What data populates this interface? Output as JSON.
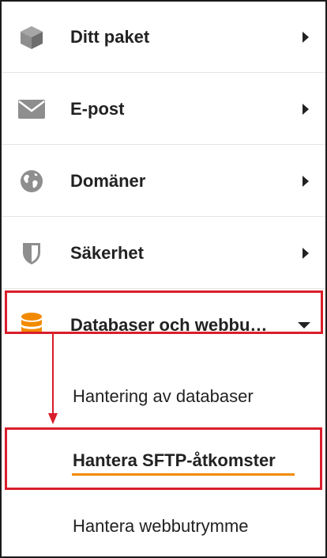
{
  "menu": {
    "items": [
      {
        "label": "Ditt paket",
        "icon": "package-icon",
        "chevron": "chevron-right-icon"
      },
      {
        "label": "E-post",
        "icon": "envelope-icon",
        "chevron": "chevron-right-icon"
      },
      {
        "label": "Domäner",
        "icon": "globe-icon",
        "chevron": "chevron-right-icon"
      },
      {
        "label": "Säkerhet",
        "icon": "shield-icon",
        "chevron": "chevron-right-icon"
      },
      {
        "label": "Databaser och webbu…",
        "icon": "database-icon",
        "chevron": "chevron-down-icon"
      }
    ],
    "subitems": [
      {
        "label": "Hantering av databaser",
        "active": false
      },
      {
        "label": "Hantera SFTP-åtkomster",
        "active": true
      },
      {
        "label": "Hantera webbutrymme",
        "active": false
      }
    ]
  },
  "colors": {
    "icon_gray": "#8e8e8e",
    "active_icon": "#f28a00",
    "highlight": "#d91e2b",
    "underline": "#f28a00",
    "text": "#222222"
  }
}
